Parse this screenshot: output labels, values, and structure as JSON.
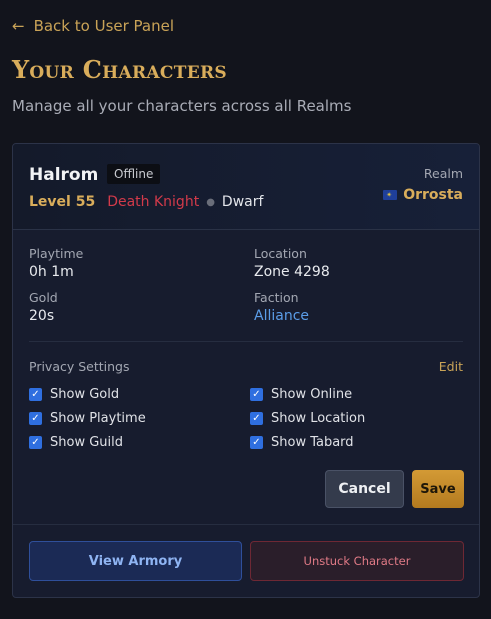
{
  "nav": {
    "back_label": "Back to User Panel"
  },
  "page": {
    "title": "Your Characters",
    "subtitle": "Manage all your characters across all Realms"
  },
  "character": {
    "name": "Halrom",
    "status": "Offline",
    "level": "Level 55",
    "class": "Death Knight",
    "race": "Dwarf",
    "realm_label": "Realm",
    "realm": "Orrosta",
    "realm_flag_icon": "eu-flag-icon",
    "stats": {
      "playtime_label": "Playtime",
      "playtime": "0h 1m",
      "location_label": "Location",
      "location": "Zone 4298",
      "gold_label": "Gold",
      "gold": "20s",
      "faction_label": "Faction",
      "faction": "Alliance"
    }
  },
  "privacy": {
    "label": "Privacy Settings",
    "edit_label": "Edit",
    "options": [
      {
        "label": "Show Gold",
        "checked": true
      },
      {
        "label": "Show Online",
        "checked": true
      },
      {
        "label": "Show Playtime",
        "checked": true
      },
      {
        "label": "Show Location",
        "checked": true
      },
      {
        "label": "Show Guild",
        "checked": true
      },
      {
        "label": "Show Tabard",
        "checked": true
      }
    ]
  },
  "actions": {
    "cancel_label": "Cancel",
    "save_label": "Save",
    "armory_label": "View Armory",
    "unstuck_label": "Unstuck Character"
  },
  "colors": {
    "accent_gold": "#d9ad5b",
    "class_color": "#d23a4a",
    "faction_color": "#5b9de8",
    "background": "#12141c"
  }
}
